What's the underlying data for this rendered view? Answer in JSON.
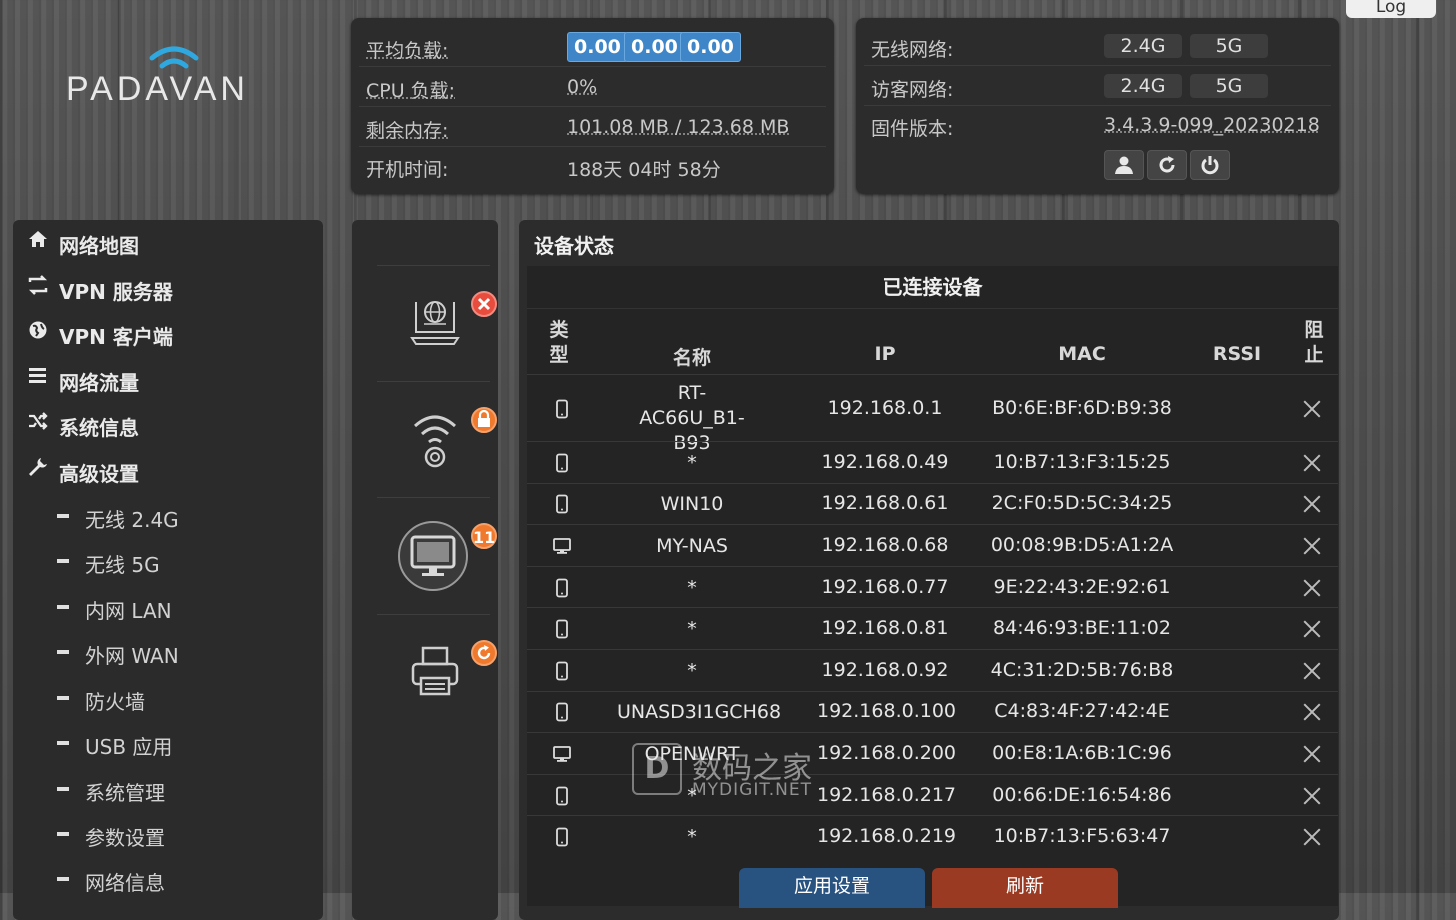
{
  "brand": {
    "logo_text": "PADAVAN"
  },
  "header": {
    "log_button": "Log"
  },
  "system_status": {
    "avg_load": {
      "label": "平均负载:",
      "values": [
        "0.00",
        "0.00",
        "0.00"
      ]
    },
    "cpu": {
      "label": "CPU 负载:",
      "value": "0%"
    },
    "memory": {
      "label": "剩余内存:",
      "value": "101.08 MB / 123.68 MB"
    },
    "uptime": {
      "label": "开机时间:",
      "value": "188天 04时 58分"
    }
  },
  "network_status": {
    "wireless": {
      "label": "无线网络:",
      "bands": [
        "2.4G",
        "5G"
      ]
    },
    "guest": {
      "label": "访客网络:",
      "bands": [
        "2.4G",
        "5G"
      ]
    },
    "firmware": {
      "label": "固件版本:",
      "value": "3.4.3.9-099_20230218"
    }
  },
  "sidebar": {
    "items": [
      {
        "label": "网络地图",
        "icon": "home-icon"
      },
      {
        "label": "VPN 服务器",
        "icon": "swap-icon"
      },
      {
        "label": "VPN 客户端",
        "icon": "globe-icon"
      },
      {
        "label": "网络流量",
        "icon": "list-icon"
      },
      {
        "label": "系统信息",
        "icon": "shuffle-icon"
      },
      {
        "label": "高级设置",
        "icon": "wrench-icon"
      }
    ],
    "subitems": [
      "无线 2.4G",
      "无线 5G",
      "内网 LAN",
      "外网 WAN",
      "防火墙",
      "USB 应用",
      "系统管理",
      "参数设置",
      "网络信息"
    ]
  },
  "devices_panel": {
    "client_count": "11"
  },
  "device_status": {
    "title": "设备状态",
    "subtitle": "已连接设备",
    "columns": {
      "type": "类型",
      "name": "名称",
      "ip": "IP",
      "mac": "MAC",
      "rssi": "RSSI",
      "block": "阻止"
    },
    "rows": [
      {
        "type": "phone",
        "name": "RT-AC66U_B1-B93",
        "ip": "192.168.0.1",
        "mac": "B0:6E:BF:6D:B9:38",
        "rssi": ""
      },
      {
        "type": "phone",
        "name": "*",
        "ip": "192.168.0.49",
        "mac": "10:B7:13:F3:15:25",
        "rssi": ""
      },
      {
        "type": "phone",
        "name": "WIN10",
        "ip": "192.168.0.61",
        "mac": "2C:F0:5D:5C:34:25",
        "rssi": ""
      },
      {
        "type": "monitor",
        "name": "MY-NAS",
        "ip": "192.168.0.68",
        "mac": "00:08:9B:D5:A1:2A",
        "rssi": ""
      },
      {
        "type": "phone",
        "name": "*",
        "ip": "192.168.0.77",
        "mac": "9E:22:43:2E:92:61",
        "rssi": ""
      },
      {
        "type": "phone",
        "name": "*",
        "ip": "192.168.0.81",
        "mac": "84:46:93:BE:11:02",
        "rssi": ""
      },
      {
        "type": "phone",
        "name": "*",
        "ip": "192.168.0.92",
        "mac": "4C:31:2D:5B:76:B8",
        "rssi": ""
      },
      {
        "type": "phone",
        "name": "UNASD3I1GCH68",
        "ip": "192.168.0.100",
        "mac": "C4:83:4F:27:42:4E",
        "rssi": ""
      },
      {
        "type": "monitor",
        "name": "OPENWRT",
        "ip": "192.168.0.200",
        "mac": "00:E8:1A:6B:1C:96",
        "rssi": ""
      },
      {
        "type": "phone",
        "name": "*",
        "ip": "192.168.0.217",
        "mac": "00:66:DE:16:54:86",
        "rssi": ""
      },
      {
        "type": "phone",
        "name": "*",
        "ip": "192.168.0.219",
        "mac": "10:B7:13:F5:63:47",
        "rssi": ""
      }
    ],
    "apply_button": "应用设置",
    "refresh_button": "刷新"
  },
  "watermark": {
    "cn": "数码之家",
    "en": "MYDIGIT.NET",
    "mark": "D"
  },
  "colors": {
    "accent_blue": "#3f86c8",
    "badge_orange": "#ef7a2e",
    "apply_blue": "#28527f",
    "refresh_red": "#9b3a22"
  }
}
